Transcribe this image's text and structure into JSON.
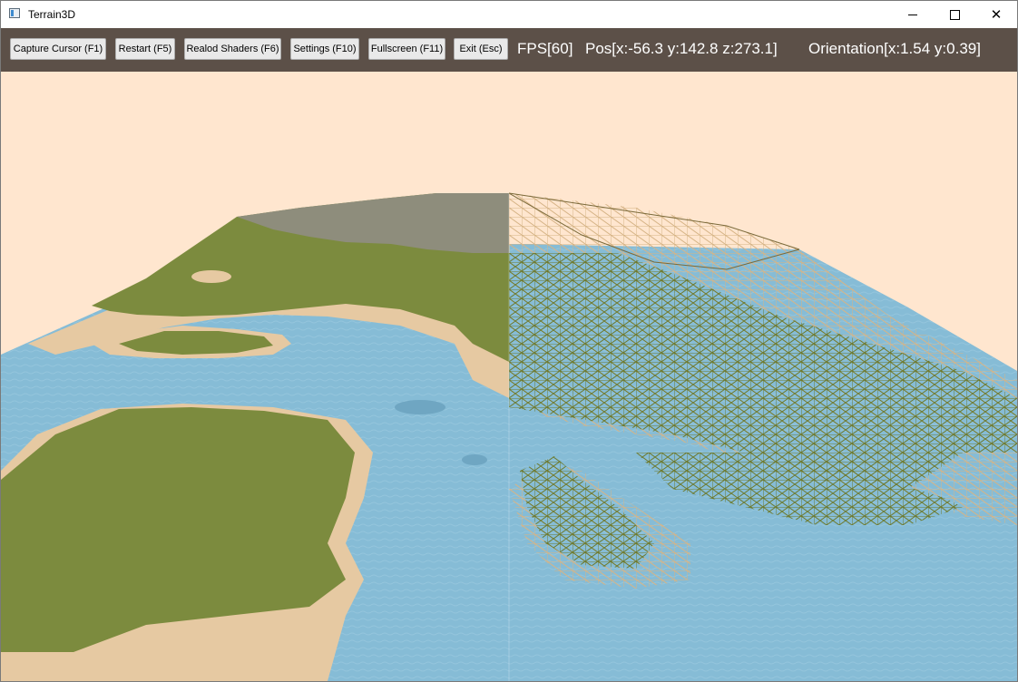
{
  "window": {
    "title": "Terrain3D",
    "controls": {
      "minimize": "minimize",
      "maximize": "maximize",
      "close": "✕"
    }
  },
  "toolbar": {
    "buttons": [
      {
        "label": "Capture Cursor (F1)"
      },
      {
        "label": "Restart (F5)"
      },
      {
        "label": "Realod Shaders (F6)"
      },
      {
        "label": "Settings (F10)"
      },
      {
        "label": "Fullscreen (F11)"
      },
      {
        "label": "Exit (Esc)"
      }
    ],
    "fps": "FPS[60]",
    "position": "Pos[x:-56.3 y:142.8 z:273.1]",
    "orientation": "Orientation[x:1.54 y:0.39]"
  },
  "scene": {
    "sky_color": "#ffe6cf",
    "water_color": "#86bcd6",
    "grass_color": "#7c8b3e",
    "sand_color": "#e6c9a2",
    "rock_color": "#8e8d7c",
    "wire_grass_color": "#6d7a2e",
    "wire_sand_color": "#d6b486"
  }
}
